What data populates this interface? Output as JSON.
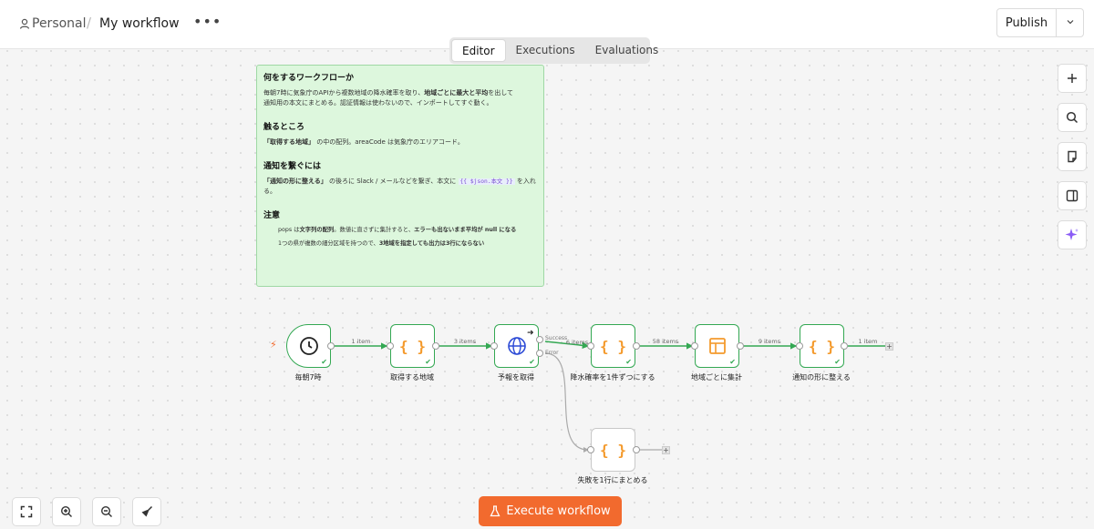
{
  "header": {
    "workspace": "Personal",
    "separator": "/",
    "workflow_name": "My workflow",
    "more_label": "•••",
    "publish_label": "Publish"
  },
  "tabs": [
    {
      "label": "Editor",
      "active": true
    },
    {
      "label": "Executions",
      "active": false
    },
    {
      "label": "Evaluations",
      "active": false
    }
  ],
  "sticky": {
    "title": "何をするワークフローか",
    "intro_a": "毎朝7時に気象庁のAPIから複数地域の降水確率を取り、",
    "intro_b": "地域ごとに最大と平均",
    "intro_c": "を出して",
    "intro_d": "通知用の本文にまとめる。認証情報は使わないので、インポートしてすぐ動く。",
    "touch_title": "触るところ",
    "touch_a": "「取得する地域」",
    "touch_b": " の中の配列。areaCode は気象庁のエリアコード。",
    "notify_title": "通知を繋ぐには",
    "notify_a": "「通知の形に整える」",
    "notify_b": " の後ろに Slack / メールなどを繋ぎ、本文に ",
    "notify_code": "{{ $json.本文 }}",
    "notify_c": " を入れる。",
    "notes_title": "注意",
    "note1_a": "pops は",
    "note1_b": "文字列の配列",
    "note1_c": "。数値に直さずに集計すると、",
    "note1_d": "エラーも出ないまま平均が null になる",
    "note2_a": "1つの県が複数の細分区域を持つので、",
    "note2_b": "3地域を指定しても出力は3行にならない"
  },
  "nodes": [
    {
      "name": "毎朝7時",
      "icon": "clock-icon"
    },
    {
      "name": "取得する地域",
      "icon": "code-braces-icon"
    },
    {
      "name": "予報を取得",
      "icon": "globe-icon"
    },
    {
      "name": "降水確率を1件ずつにする",
      "icon": "code-braces-icon"
    },
    {
      "name": "地域ごとに集計",
      "icon": "table-icon"
    },
    {
      "name": "通知の形に整える",
      "icon": "code-braces-icon"
    },
    {
      "name": "失敗を1行にまとめる",
      "icon": "code-braces-icon"
    }
  ],
  "node_icon_text": "{ }",
  "edges": {
    "e1": "1 item",
    "e2": "3 items",
    "e3": "6 items",
    "e4": "58 items",
    "e5": "9 items",
    "e6": "1 item"
  },
  "outputs": {
    "success": "Success",
    "error": "Error"
  },
  "execute_label": "Execute workflow",
  "colors": {
    "accent": "#f26a2e",
    "success": "#34a853",
    "code_icon": "#f49a2c",
    "globe_icon": "#2d4bd6"
  }
}
